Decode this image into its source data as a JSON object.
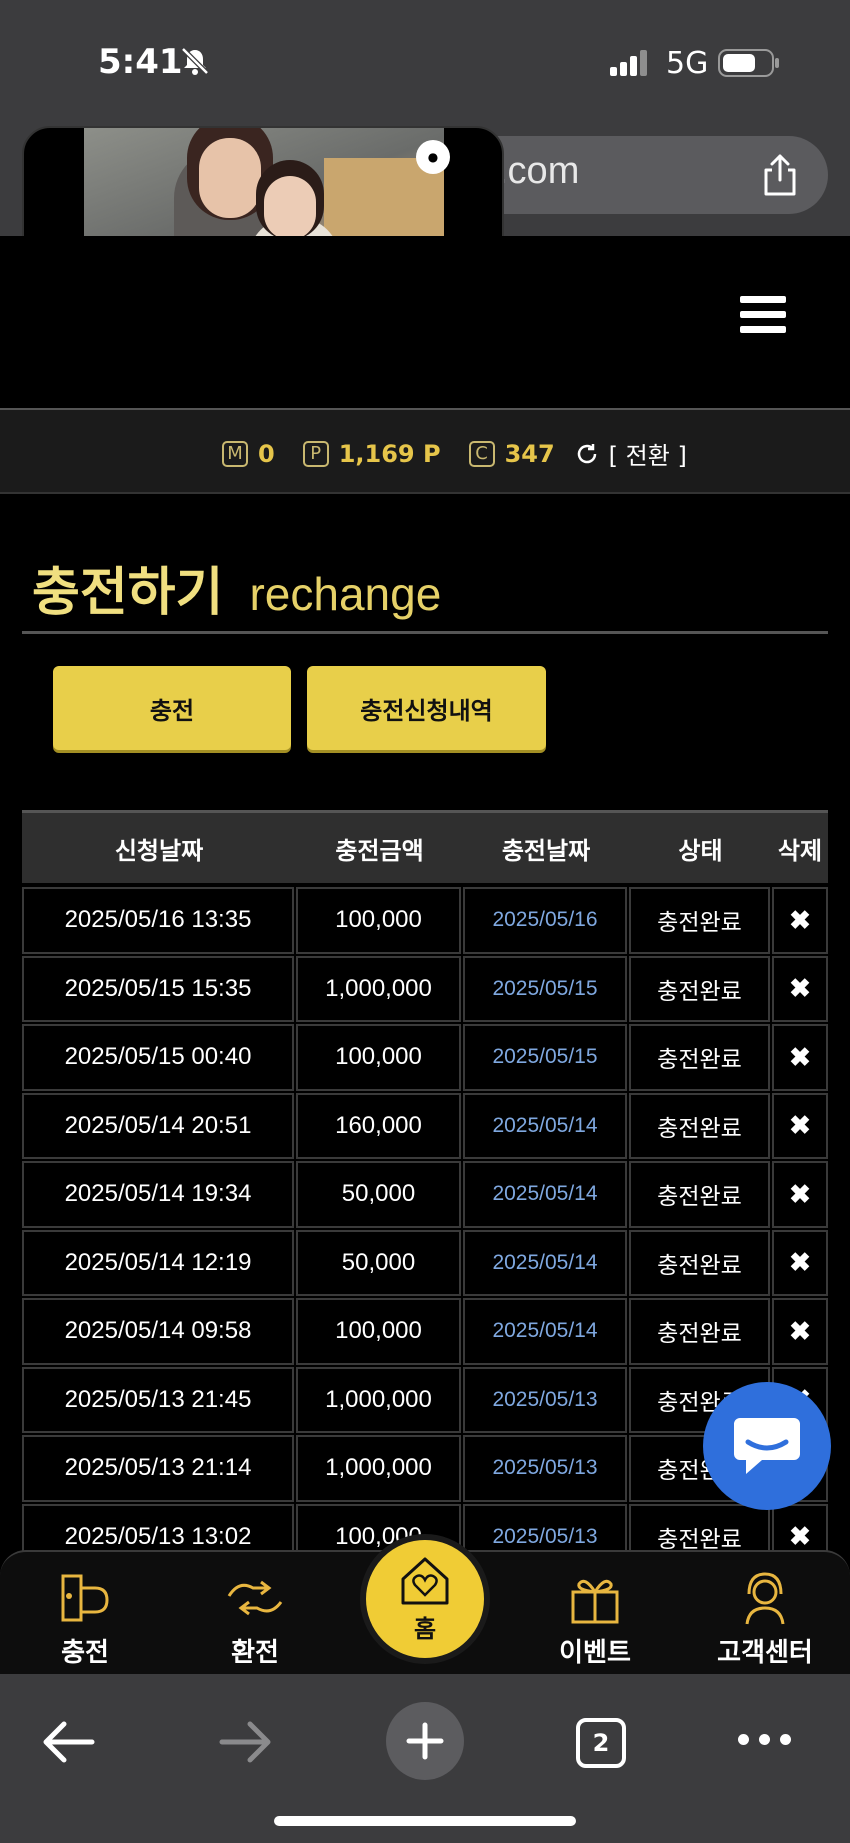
{
  "status_bar": {
    "time": "5:41",
    "network": "5G"
  },
  "browser": {
    "url_fragment": ".com",
    "tab_count": "2"
  },
  "balance": {
    "m_badge": "M",
    "m_value": "0",
    "p_badge": "P",
    "p_value": "1,169 P",
    "c_badge": "C",
    "c_value": "347",
    "switch_label": "[ 전환 ]"
  },
  "page": {
    "title": "충전하기",
    "subtitle": "rechange"
  },
  "buttons": {
    "charge": "충전",
    "history": "충전신청내역"
  },
  "table": {
    "headers": [
      "신청날짜",
      "충전금액",
      "충전날짜",
      "상태",
      "삭제"
    ],
    "rows": [
      [
        "2025/05/16 13:35",
        "100,000",
        "2025/05/16",
        "충전완료"
      ],
      [
        "2025/05/15 15:35",
        "1,000,000",
        "2025/05/15",
        "충전완료"
      ],
      [
        "2025/05/15 00:40",
        "100,000",
        "2025/05/15",
        "충전완료"
      ],
      [
        "2025/05/14 20:51",
        "160,000",
        "2025/05/14",
        "충전완료"
      ],
      [
        "2025/05/14 19:34",
        "50,000",
        "2025/05/14",
        "충전완료"
      ],
      [
        "2025/05/14 12:19",
        "50,000",
        "2025/05/14",
        "충전완료"
      ],
      [
        "2025/05/14 09:58",
        "100,000",
        "2025/05/14",
        "충전완료"
      ],
      [
        "2025/05/13 21:45",
        "1,000,000",
        "2025/05/13",
        "충전완료"
      ],
      [
        "2025/05/13 21:14",
        "1,000,000",
        "2025/05/13",
        "충전완료"
      ],
      [
        "2025/05/13 13:02",
        "100,000",
        "2025/05/13",
        "충전완료"
      ]
    ],
    "delete_symbol": "✖"
  },
  "bottom_nav": {
    "items": [
      {
        "label": "충전",
        "icon": "charge-icon"
      },
      {
        "label": "환전",
        "icon": "exchange-icon"
      },
      {
        "label": "홈",
        "icon": "home-heart-icon"
      },
      {
        "label": "이벤트",
        "icon": "gift-icon"
      },
      {
        "label": "고객센터",
        "icon": "support-agent-icon"
      }
    ]
  },
  "colors": {
    "accent": "#e8cf4a",
    "title": "#f0df80",
    "link_date": "#7fa8e0",
    "chat": "#2f6fdc"
  }
}
